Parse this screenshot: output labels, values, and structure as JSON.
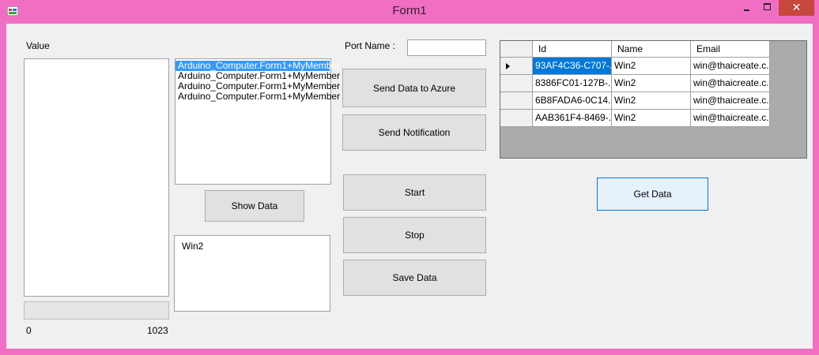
{
  "window": {
    "title": "Form1",
    "close_glyph": "✕"
  },
  "value_label": "Value",
  "track": {
    "min": "0",
    "max": "1023",
    "level": 0
  },
  "member_list": {
    "items": [
      "Arduino_Computer.Form1+MyMember",
      "Arduino_Computer.Form1+MyMember",
      "Arduino_Computer.Form1+MyMember",
      "Arduino_Computer.Form1+MyMember"
    ],
    "selected_index": 0
  },
  "show_data_label": "Show Data",
  "name_box_value": "Win2",
  "port": {
    "label": "Port Name :",
    "value": ""
  },
  "buttons": {
    "send_azure": "Send Data to Azure",
    "send_notification": "Send Notification",
    "start": "Start",
    "stop": "Stop",
    "save": "Save Data",
    "get_data": "Get Data"
  },
  "grid": {
    "columns": [
      "Id",
      "Name",
      "Email"
    ],
    "rows": [
      {
        "id": "93AF4C36-C707-...",
        "name": "Win2",
        "email": "win@thaicreate.c..."
      },
      {
        "id": "8386FC01-127B-...",
        "name": "Win2",
        "email": "win@thaicreate.c..."
      },
      {
        "id": "6B8FADA6-0C14...",
        "name": "Win2",
        "email": "win@thaicreate.c..."
      },
      {
        "id": "AAB361F4-8469-...",
        "name": "Win2",
        "email": "win@thaicreate.c..."
      }
    ],
    "selected_row": 0
  },
  "colors": {
    "frame": "#f06ec4",
    "close_button": "#c7463d",
    "selection": "#0078d7",
    "list_selection": "#3399ff"
  }
}
